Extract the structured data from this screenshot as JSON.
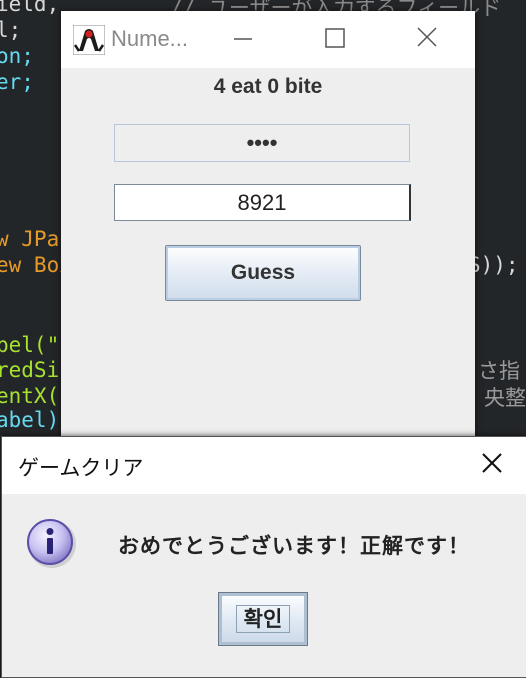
{
  "editor": {
    "lines": [
      {
        "text": "ield,",
        "color": "#d7d7d7"
      },
      {
        "text": "l;",
        "color": "#d7d7d7"
      },
      {
        "text": "on;",
        "color": "#66d9ef"
      },
      {
        "text": "er;",
        "color": "#66d9ef"
      },
      {
        "text": "w JPar",
        "color": "#e69a28"
      },
      {
        "text": "ew Box",
        "color": "#e69a28"
      },
      {
        "text": "S));",
        "color": "#d7d7d7"
      },
      {
        "text": "bel(\"",
        "color": "#a6e22e"
      },
      {
        "text": "redSiz",
        "color": "#a6e22e"
      },
      {
        "text": "entX(",
        "color": "#a6e22e"
      },
      {
        "text": "abel)",
        "color": "#66d9ef"
      },
      {
        "text": "さ指",
        "color": "#9a9a9a"
      },
      {
        "text": "央整",
        "color": "#9a9a9a"
      },
      {
        "text": "// ユーザーが入力するフィールド",
        "color": "#8a8a8a"
      }
    ]
  },
  "window": {
    "title": "Nume...",
    "score_text": "4 eat 0 bite",
    "secret_text": "••••",
    "guess_value": "8921",
    "guess_button_label": "Guess"
  },
  "dialog": {
    "title": "ゲームクリア",
    "message": "おめでとうございます！正解です！",
    "ok_label": "확인"
  },
  "colors": {
    "editor_bg": "#232629",
    "window_bg": "#eeeeee",
    "titlebar_bg": "#ffffff",
    "button_border": "#7a8a9a"
  }
}
